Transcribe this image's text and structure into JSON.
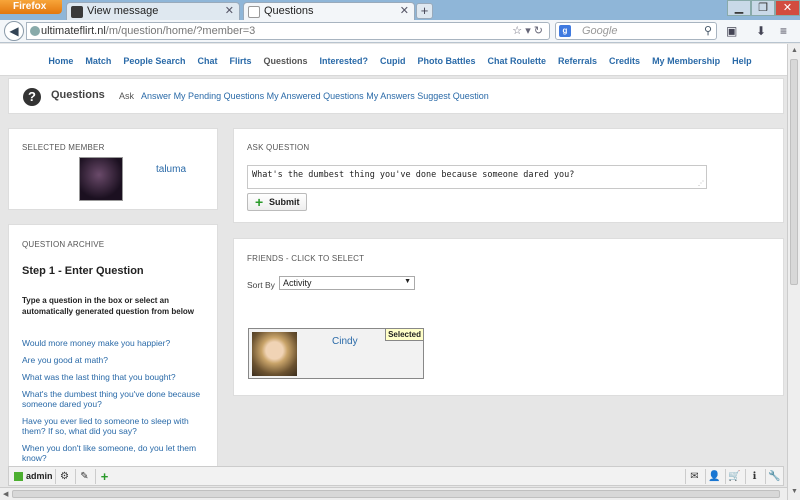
{
  "browser": {
    "app_button": "Firefox",
    "tabs": [
      {
        "label": "View message"
      },
      {
        "label": "Questions"
      }
    ],
    "new_tab": "+",
    "url_host": "ultimateflirt.nl",
    "url_path": "/m/question/home/?member=3",
    "search_engine": "g",
    "search_placeholder": "Google"
  },
  "site_nav": {
    "items": [
      "Home",
      "Match",
      "People Search",
      "Chat",
      "Flirts",
      "Questions",
      "Interested?",
      "Cupid",
      "Photo Battles",
      "Chat Roulette",
      "Referrals",
      "Credits",
      "My Membership",
      "Help"
    ],
    "active": "Questions"
  },
  "header": {
    "icon": "?",
    "title": "Questions",
    "links": [
      "Ask",
      "Answer",
      "My Pending Questions",
      "My Answered Questions",
      "My Answers",
      "Suggest Question"
    ]
  },
  "selected_member": {
    "heading": "SELECTED MEMBER",
    "name": "taluma"
  },
  "ask": {
    "heading": "ASK QUESTION",
    "question_value": "What's the dumbest thing you've done because someone dared you?",
    "submit_label": "Submit"
  },
  "archive": {
    "heading": "QUESTION ARCHIVE",
    "step_title": "Step 1 - Enter Question",
    "step_desc": "Type a question in the box or select an automatically generated question from below",
    "questions": [
      "Would more money make you happier?",
      "Are you good at math?",
      "What was the last thing that you bought?",
      "What's the dumbest thing you've done because someone dared you?",
      "Have you ever lied to someone to sleep with them? If so, what did you say?",
      "When you don't like someone, do you let them know?"
    ]
  },
  "friends": {
    "heading": "FRIENDS - CLICK TO SELECT",
    "sort_label": "Sort By",
    "sort_value": "Activity",
    "card_name": "Cindy",
    "card_badge": "Selected"
  },
  "bottom_bar": {
    "user": "admin",
    "online_color": "#4caf30"
  },
  "colors": {
    "link": "#2a6aa8",
    "firefox_orange": "#e3770d",
    "badge_bg": "#ffffc8"
  }
}
